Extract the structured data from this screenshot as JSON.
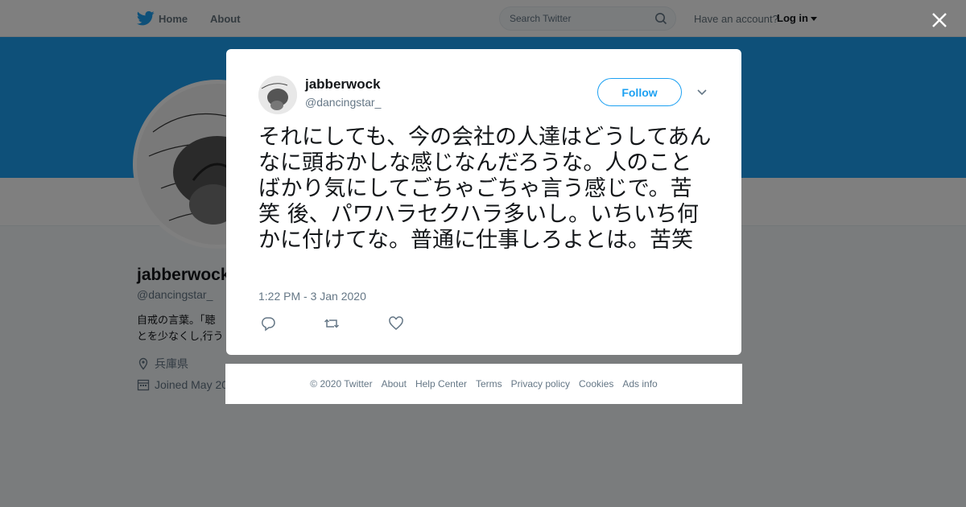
{
  "topbar": {
    "home_label": "Home",
    "about_label": "About",
    "search_placeholder": "Search Twitter",
    "have_account": "Have an account?",
    "login_label": "Log in"
  },
  "profile": {
    "name": "jabberwock",
    "handle": "@dancingstar_",
    "bio": "自戒の言葉。「聴…とを少なくし,行う…",
    "bio_line1": "自戒の言葉。「聴",
    "bio_line2": "とを少なくし,行う",
    "location": "兵庫県",
    "joined": "Joined May 20"
  },
  "tweet": {
    "display_name": "jabberwock",
    "screen_name": "@dancingstar_",
    "follow_label": "Follow",
    "text": "それにしても、今の会社の人達はどうしてあんなに頭おかしな感じなんだろうな。人のことばかり気にしてごちゃごちゃ言う感じで。苦笑 後、パワハラセクハラ多いし。いちいち何かに付けてな。普通に仕事しろよとは。苦笑",
    "timestamp": "1:22 PM - 3 Jan 2020"
  },
  "footer": {
    "copyright": "© 2020 Twitter",
    "about": "About",
    "help": "Help Center",
    "terms": "Terms",
    "privacy": "Privacy policy",
    "cookies": "Cookies",
    "ads": "Ads info"
  },
  "colors": {
    "brand": "#1da1f2",
    "text_primary": "#14171a",
    "text_secondary": "#657786"
  },
  "icons": [
    "twitter-bird-icon",
    "search-icon",
    "caret-down-icon",
    "close-icon",
    "chevron-down-icon",
    "reply-icon",
    "retweet-icon",
    "heart-icon",
    "location-pin-icon",
    "calendar-icon"
  ]
}
